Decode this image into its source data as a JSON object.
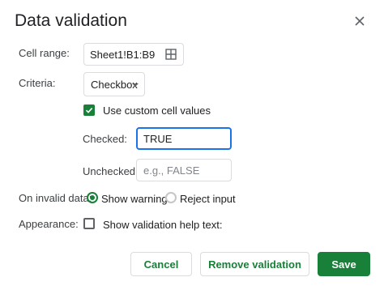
{
  "dialog": {
    "title": "Data validation",
    "close_icon": "close-icon"
  },
  "cell_range": {
    "label": "Cell range:",
    "value": "Sheet1!B1:B9",
    "icon": "grid-select-icon"
  },
  "criteria": {
    "label": "Criteria:",
    "value": "Checkbox"
  },
  "custom_values": {
    "label": "Use custom cell values",
    "checked": true,
    "checked_label": "Checked:",
    "checked_value": "TRUE",
    "unchecked_label": "Unchecked:",
    "unchecked_placeholder": "e.g., FALSE"
  },
  "invalid_data": {
    "label": "On invalid data:",
    "options": [
      "Show warning",
      "Reject input"
    ],
    "selected": "Show warning"
  },
  "appearance": {
    "label": "Appearance:",
    "help_text_label": "Show validation help text:",
    "checked": false
  },
  "buttons": {
    "cancel": "Cancel",
    "remove": "Remove validation",
    "save": "Save"
  },
  "colors": {
    "accent": "#188038",
    "focus": "#1a73e8"
  }
}
